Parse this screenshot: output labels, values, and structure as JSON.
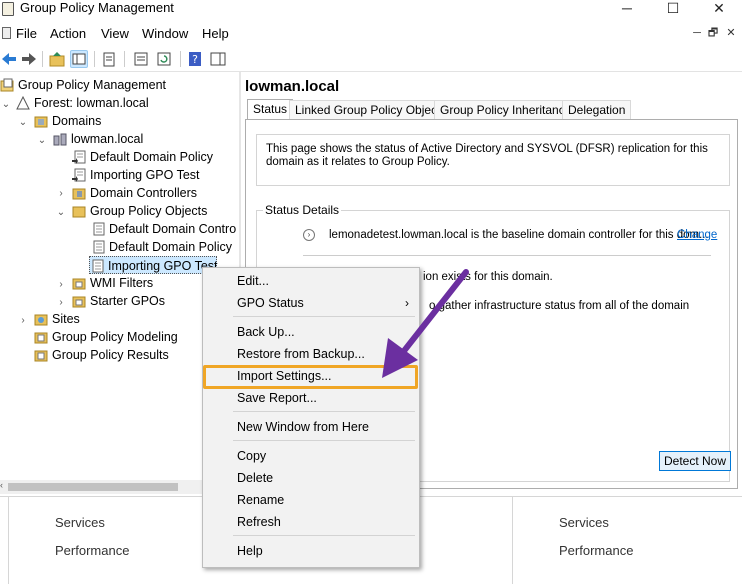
{
  "window": {
    "title": "Group Policy Management",
    "icon": "gpmc-app-icon"
  },
  "window_controls": {
    "minimize": "─",
    "maximize": "☐",
    "close": "✕"
  },
  "mdi_controls": {
    "minimize": "─",
    "restore": "🗗",
    "close": "✕"
  },
  "menubar": {
    "items": [
      "File",
      "Action",
      "View",
      "Window",
      "Help"
    ]
  },
  "toolbar": {
    "icons": [
      "back-arrow-icon",
      "forward-arrow-icon",
      "up-folder-icon",
      "show-hide-tree-icon",
      "properties-icon",
      "export-list-icon",
      "refresh-icon",
      "help-icon",
      "action-pane-icon"
    ]
  },
  "tree": {
    "root": "Group Policy Management",
    "forest": "Forest: lowman.local",
    "domains": "Domains",
    "domain": "lowman.local",
    "gpo_links": [
      "Default Domain Policy",
      "Importing GPO Test"
    ],
    "domain_controllers": "Domain Controllers",
    "group_policy_objects": "Group Policy Objects",
    "gpos": [
      "Default Domain Contro",
      "Default Domain Policy",
      "Importing GPO Test"
    ],
    "wmi_filters": "WMI Filters",
    "starter_gpos": "Starter GPOs",
    "sites": "Sites",
    "modeling": "Group Policy Modeling",
    "results": "Group Policy Results"
  },
  "right_pane": {
    "heading": "lowman.local",
    "tabs": [
      "Status",
      "Linked Group Policy Objects",
      "Group Policy Inheritance",
      "Delegation"
    ],
    "info_text": "This page shows the status of Active Directory and SYSVOL (DFSR) replication for this domain as it relates to Group Policy.",
    "status_details_label": "Status Details",
    "baseline_text": "lemonadetest.lowman.local is the baseline domain controller for this dom...",
    "change_link": "Change",
    "partial_line_1": "ion exists for this domain.",
    "partial_line_2": "o gather infrastructure status from all of the domain",
    "detect_button": "Detect Now"
  },
  "bottom": {
    "services": "Services",
    "performance": "Performance"
  },
  "context_menu": {
    "items": [
      "Edit...",
      "GPO Status",
      "Back Up...",
      "Restore from Backup...",
      "Import Settings...",
      "Save Report...",
      "New Window from Here",
      "Copy",
      "Delete",
      "Rename",
      "Refresh",
      "Help"
    ],
    "submenu_arrow": "›"
  },
  "annotation": {
    "highlight_color": "#f0a626",
    "arrow_color": "#6b2fa0"
  },
  "colors": {
    "selection": "#cce8ff",
    "link": "#0066cc",
    "button_border": "#0078d7"
  }
}
